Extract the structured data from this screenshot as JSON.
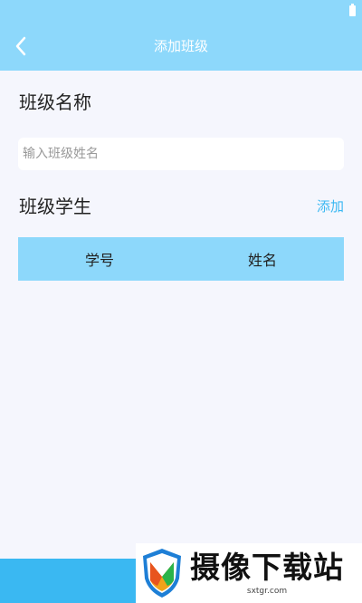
{
  "header": {
    "title": "添加班级",
    "back_icon": "chevron-left-icon",
    "color": "#8dd8fb"
  },
  "class_name": {
    "label": "班级名称",
    "placeholder": "输入班级姓名",
    "value": ""
  },
  "students": {
    "label": "班级学生",
    "add_label": "添加",
    "columns": [
      "学号",
      "姓名"
    ],
    "rows": []
  },
  "watermark": {
    "title": "摄像下载站",
    "subtitle": "sxtgr.com"
  },
  "colors": {
    "accent": "#3ab8f2",
    "background": "#f5f6fd"
  }
}
